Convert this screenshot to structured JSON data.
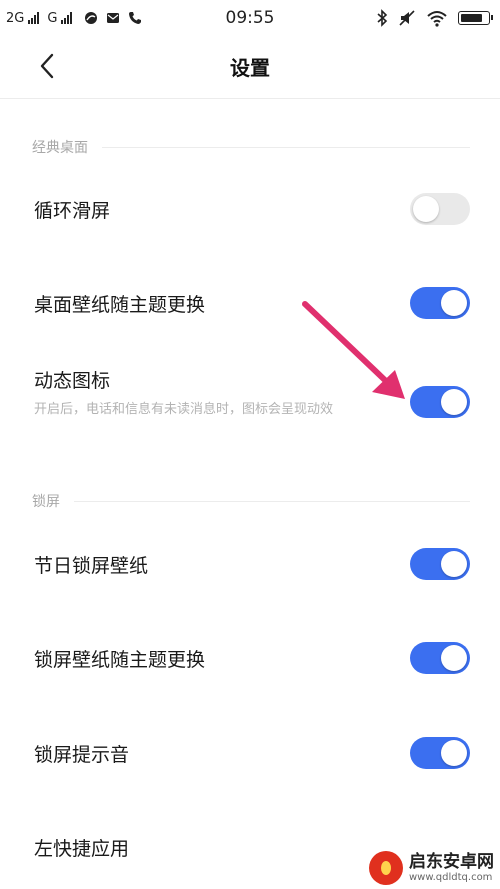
{
  "status_bar": {
    "net1": "2G",
    "net2": "G",
    "time": "09:55"
  },
  "header": {
    "title": "设置"
  },
  "sections": {
    "classic_desktop": "经典桌面",
    "lock_screen": "锁屏"
  },
  "settings": {
    "loop_scroll": {
      "label": "循环滑屏",
      "enabled": false
    },
    "wallpaper_theme": {
      "label": "桌面壁纸随主题更换",
      "enabled": true
    },
    "dynamic_icon": {
      "label": "动态图标",
      "desc": "开启后，电话和信息有未读消息时，图标会呈现动效",
      "enabled": true
    },
    "holiday_wallpaper": {
      "label": "节日锁屏壁纸",
      "enabled": true
    },
    "lock_wallpaper_theme": {
      "label": "锁屏壁纸随主题更换",
      "enabled": true
    },
    "lock_sound": {
      "label": "锁屏提示音",
      "enabled": true
    },
    "left_shortcut": {
      "label": "左快捷应用"
    }
  },
  "annotation": {
    "arrow_color": "#e0306e",
    "accent": "#3b6ff0"
  },
  "watermark": {
    "title": "启东安卓网",
    "url": "www.qdldtq.com"
  }
}
